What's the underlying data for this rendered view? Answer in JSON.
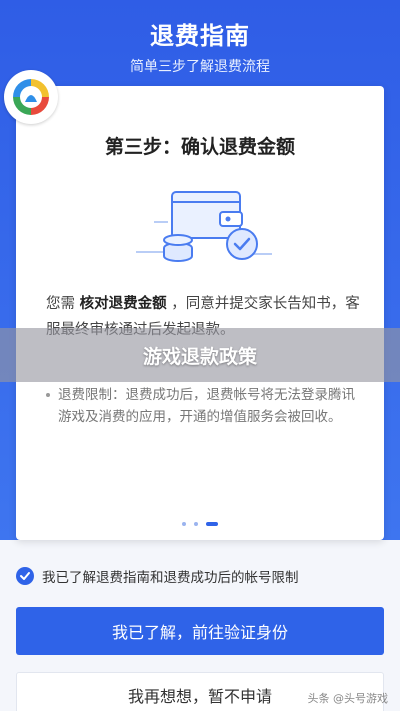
{
  "header": {
    "title": "退费指南",
    "subtitle": "简单三步了解退费流程"
  },
  "card": {
    "step_title": "第三步：确认退费金额",
    "desc_prefix": "您需 ",
    "desc_bold": "核对退费金额",
    "desc_suffix": " ，同意并提交家长告知书，客服最终审核通过后发起退款。",
    "note": "退费限制：退费成功后，退费帐号将无法登录腾讯游戏及消费的应用，开通的增值服务会被回收。",
    "pagination": {
      "total": 3,
      "active_index": 2
    }
  },
  "overlay": {
    "text": "游戏退款政策"
  },
  "agreement": {
    "label": "我已了解退费指南和退费成功后的帐号限制",
    "checked": true
  },
  "buttons": {
    "primary": "我已了解，前往验证身份",
    "secondary": "我再想想，暂不申请"
  },
  "watermark": "头条 @头号游戏",
  "colors": {
    "accent": "#2f63e8",
    "header_bg": "#3f76f0"
  },
  "icons": {
    "badge": "app-logo-icon",
    "illustration": "wallet-coins-check-icon",
    "check": "checkmark-icon"
  }
}
